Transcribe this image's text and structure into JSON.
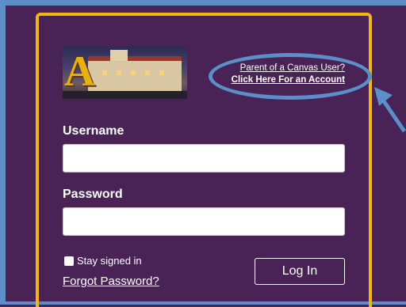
{
  "header": {
    "logo_icon": "st-augustine-school-logo",
    "parent_link_line1": "Parent of a Canvas User?",
    "parent_link_line2": "Click Here For an Account"
  },
  "form": {
    "username_label": "Username",
    "username_value": "",
    "password_label": "Password",
    "password_value": "",
    "stay_signed_in_label": "Stay signed in",
    "stay_signed_in_checked": false,
    "forgot_password_label": "Forgot Password?",
    "login_button_label": "Log In"
  },
  "colors": {
    "background": "#4a2356",
    "panel_border": "#f2b416",
    "annotation": "#5b8fc9"
  }
}
